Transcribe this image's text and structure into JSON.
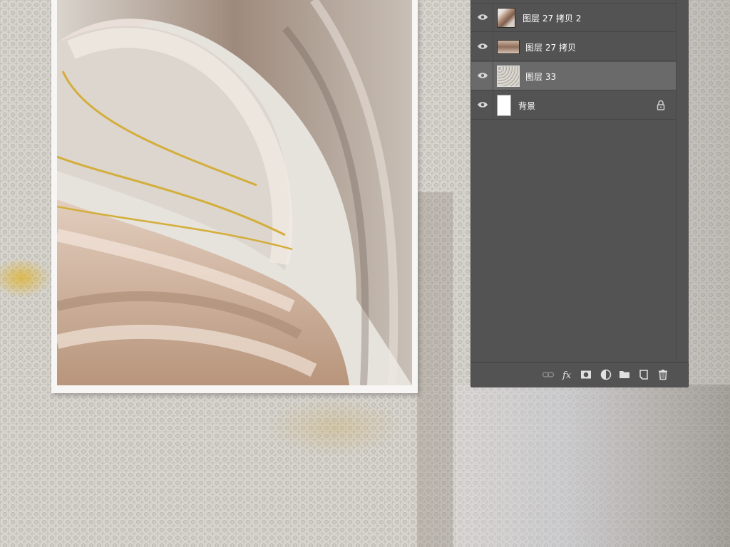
{
  "background": {
    "texture": "embossed-stucco",
    "accent": "#d9ae2a"
  },
  "artwork": {
    "description_colors": [
      "#efe7df",
      "#c9a98d",
      "#8d7a6c",
      "#d4ae3c"
    ]
  },
  "layers_panel": {
    "layers": [
      {
        "name": "图层 27 拷贝 2",
        "visible": true,
        "selected": false,
        "locked": false,
        "thumb": "brown-swirl"
      },
      {
        "name": "图层 27 拷贝",
        "visible": true,
        "selected": false,
        "locked": false,
        "thumb": "tan-wood"
      },
      {
        "name": "图层 33",
        "visible": true,
        "selected": true,
        "locked": false,
        "thumb": "grey-texture"
      },
      {
        "name": "背景",
        "visible": true,
        "selected": false,
        "locked": true,
        "thumb": "white"
      }
    ],
    "bottom_tools": [
      "link-layers-icon",
      "fx-icon",
      "mask-icon",
      "adjustment-icon",
      "folder-icon",
      "new-layer-icon",
      "trash-icon"
    ],
    "colors": {
      "panel": "#535353",
      "selected": "#6a6a6a",
      "text": "#ffffff"
    }
  }
}
